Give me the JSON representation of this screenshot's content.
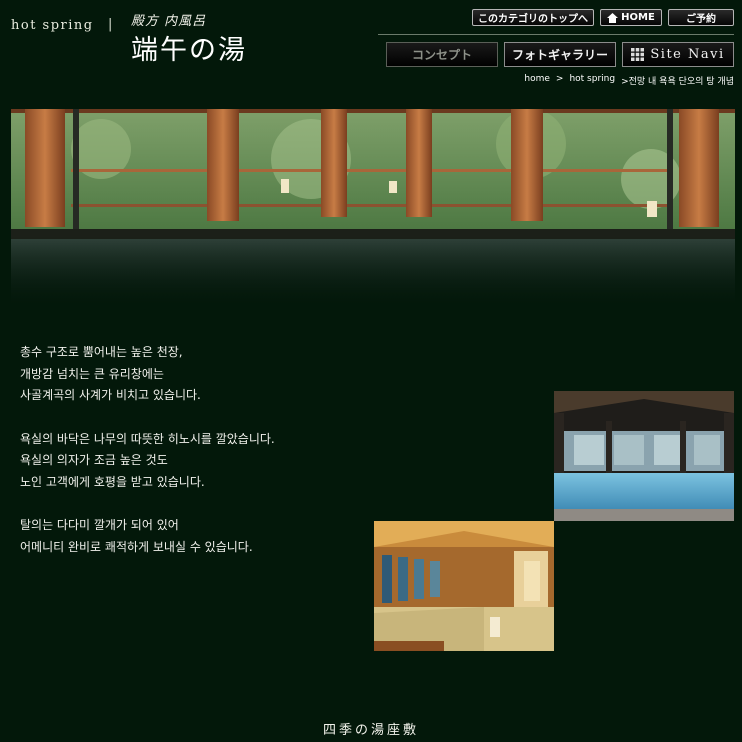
{
  "header": {
    "brand": "hot spring",
    "separator": "|",
    "logo_sub": "殿方 内風呂",
    "logo_main": "端午の湯"
  },
  "top_buttons": {
    "category_top": "このカテゴリのトップへ",
    "home": "HOME",
    "reserve": "ご予約"
  },
  "nav": {
    "concept": "コンセプト",
    "gallery": "フォトギャラリー",
    "site_navi": "Site Navi"
  },
  "breadcrumb": {
    "home": "home",
    "sep1": ">",
    "hot_spring": "hot spring",
    "current": ">전망 내 욕욕 단오의 탕 개념"
  },
  "content": {
    "paragraphs": [
      [
        "총수 구조로 뿜어내는 높은 천장,",
        "개방감 넘치는 큰 유리창에는",
        "사골계곡의 사계가 비치고 있습니다."
      ],
      [
        "욕실의 바닥은 나무의 따뜻한 히노시를 깔았습니다.",
        "욕실의 의자가 조금 높은 것도",
        "노인 고객에게 호평을 받고 있습니다."
      ],
      [
        "탈의는 다다미 깔개가 되어 있어",
        "어메니티 완비로 쾌적하게 보내실 수 있습니다."
      ]
    ]
  },
  "footer": {
    "title": "四季の湯座敷"
  },
  "colors": {
    "background": "#03180a",
    "text": "#f1f1ec",
    "button_border": "#b6b6b6"
  },
  "icons": {
    "home": "house-icon",
    "site_navi": "grid-icon"
  }
}
